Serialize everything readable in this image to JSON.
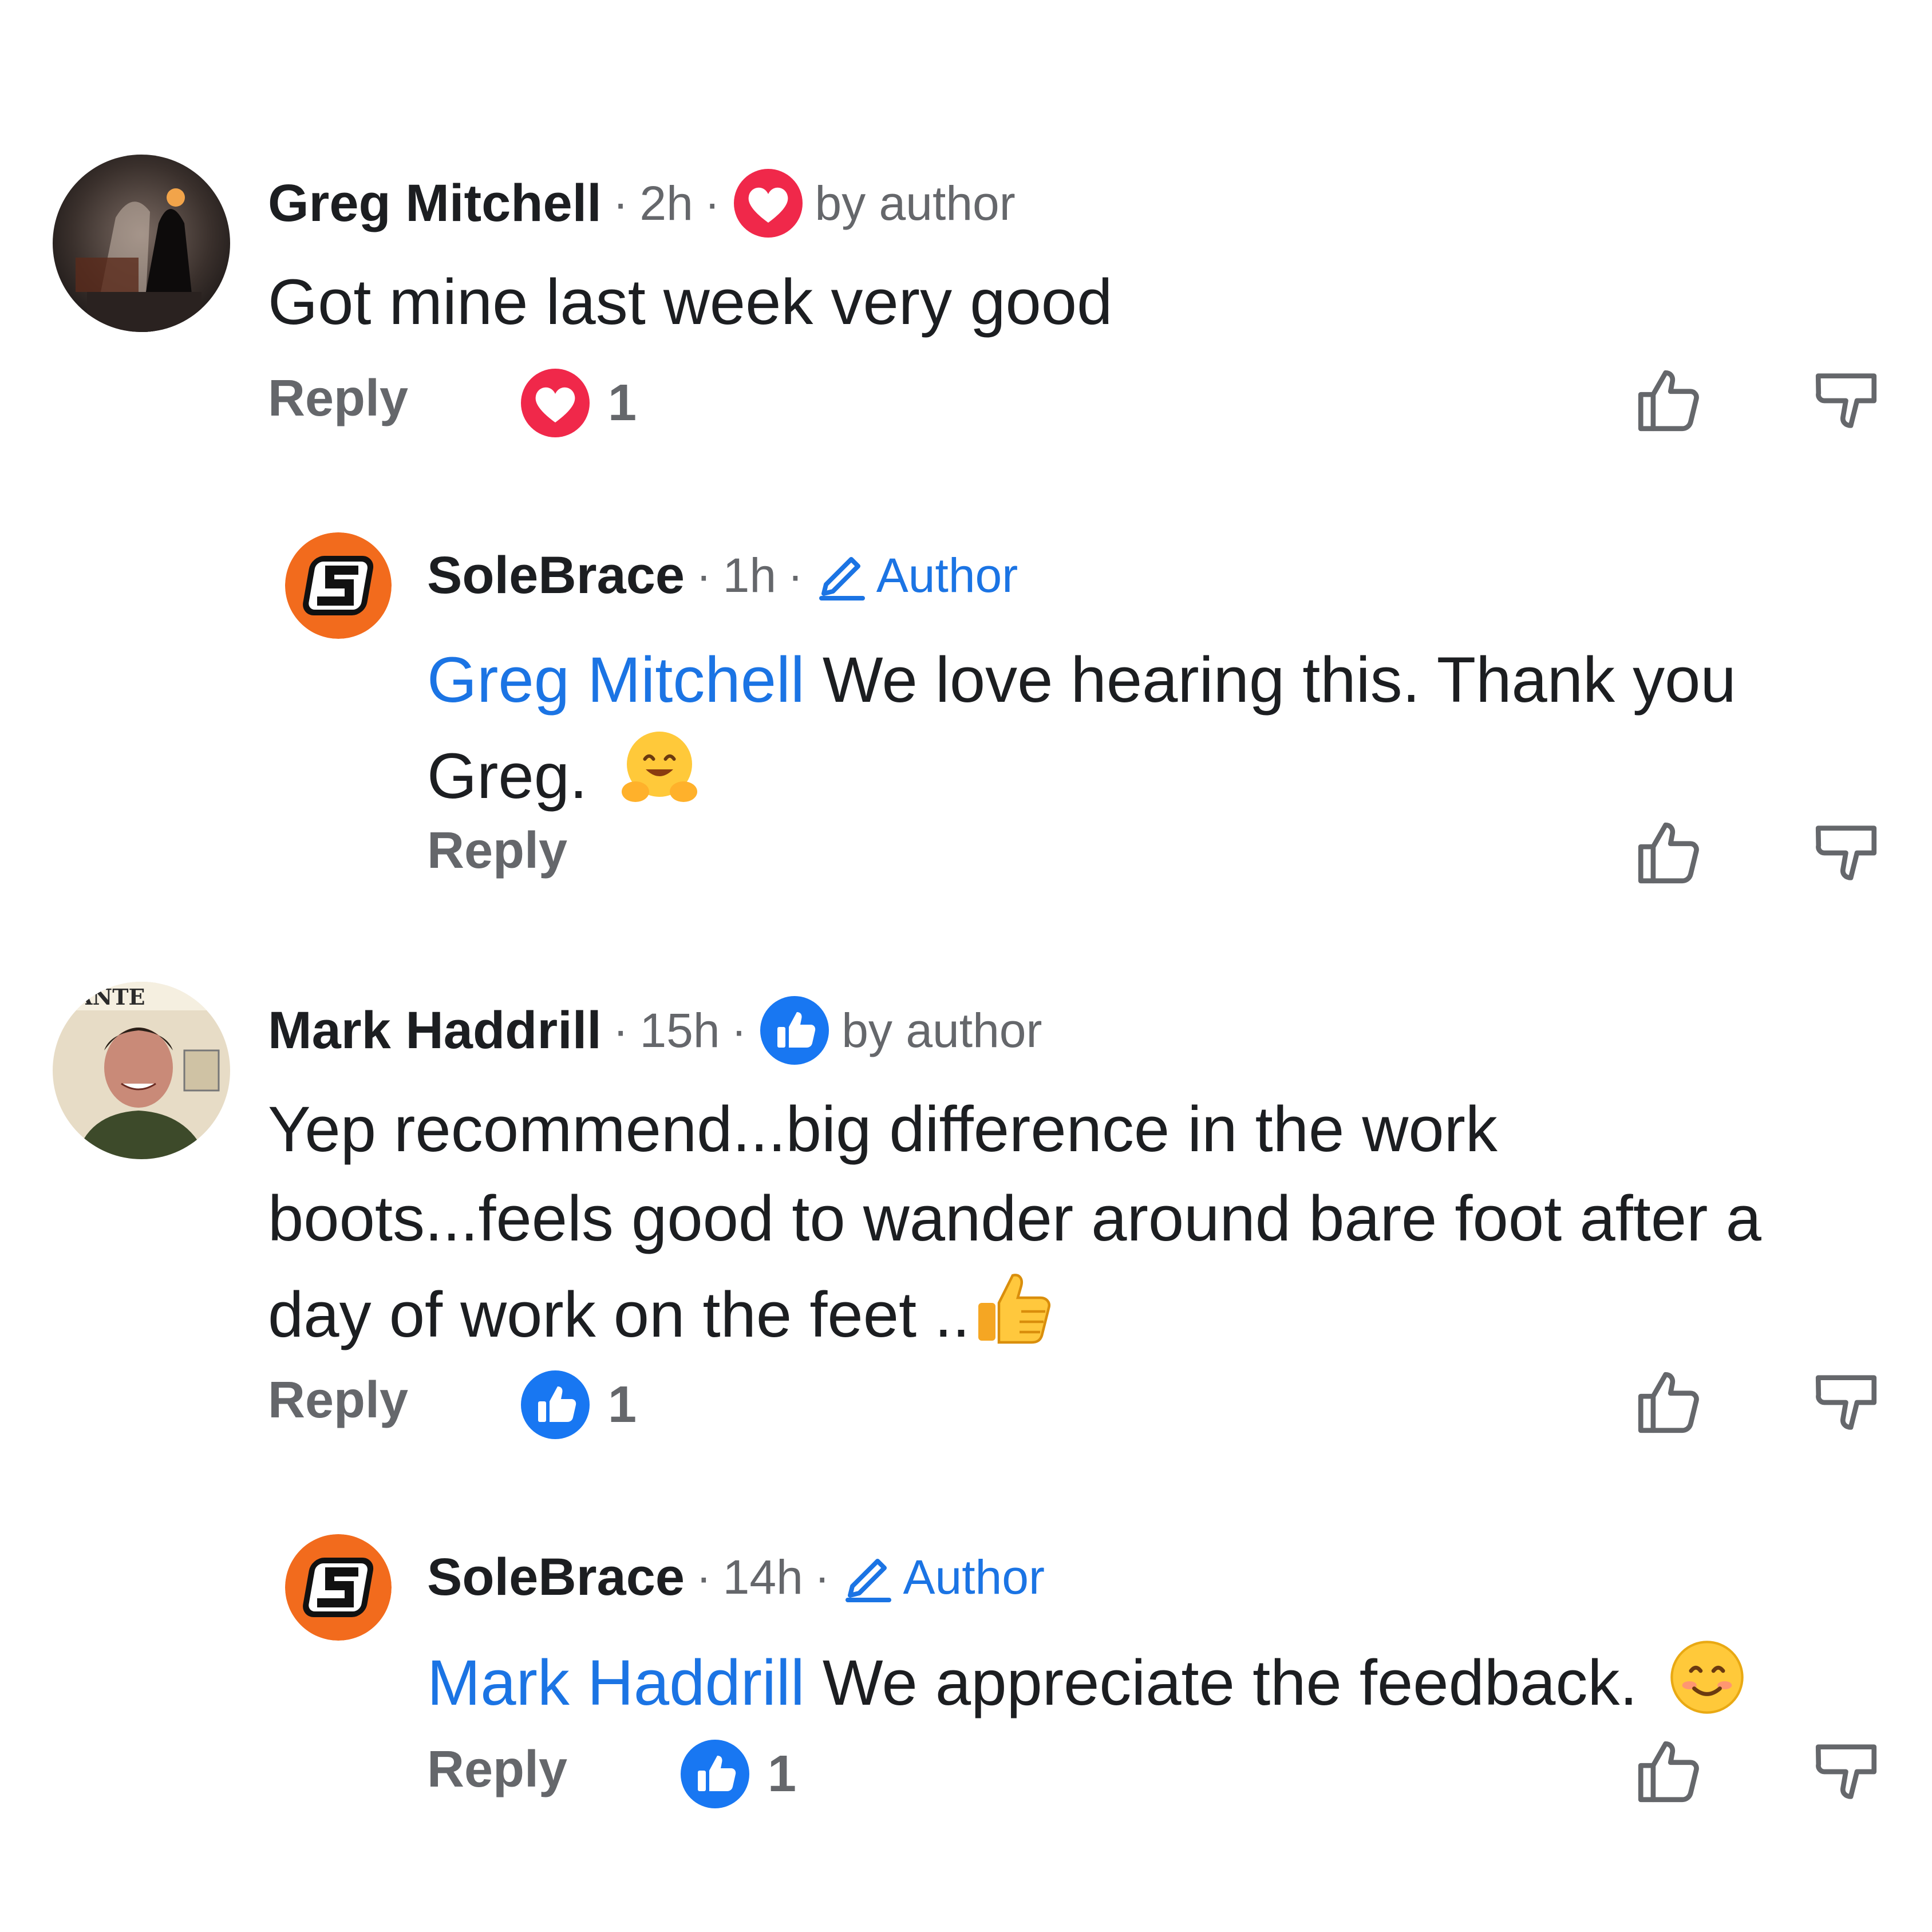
{
  "comments": [
    {
      "name": "Greg Mitchell",
      "time": "2h",
      "badge_text": "by author",
      "text": "Got mine  last week  very  good",
      "reply_label": "Reply",
      "reaction_count": "1",
      "reaction_type": "heart",
      "avatar": "greg-mitchell-photo"
    },
    {
      "name": "SoleBrace",
      "time": "1h",
      "badge_text": "Author",
      "mention": "Greg Mitchell",
      "text_line1": " We love hearing this. Thank you",
      "text_line2": "Greg.",
      "emoji": "hugging-face",
      "reply_label": "Reply",
      "avatar": "solebrace-logo"
    },
    {
      "name": "Mark Haddrill",
      "time": "15h",
      "badge_text": "by author",
      "text_line1": "Yep recommend...big difference in the work",
      "text_line2": "boots...feels good to wander around bare foot after a",
      "text_line3": "day of work on the feet ..",
      "emoji": "thumbs-up",
      "reply_label": "Reply",
      "reaction_count": "1",
      "reaction_type": "like",
      "avatar": "mark-haddrill-photo"
    },
    {
      "name": "SoleBrace",
      "time": "14h",
      "badge_text": "Author",
      "mention": "Mark Haddrill",
      "text": " We appreciate the feedback.",
      "emoji": "smiling-face",
      "reply_label": "Reply",
      "reaction_count": "1",
      "reaction_type": "like",
      "avatar": "solebrace-logo"
    }
  ],
  "separator": "·",
  "colors": {
    "link_blue": "#1b74e4",
    "muted_gray": "#65676b",
    "heart_red": "#f0284a",
    "like_blue": "#1877f2",
    "brand_orange": "#f26b1d"
  }
}
